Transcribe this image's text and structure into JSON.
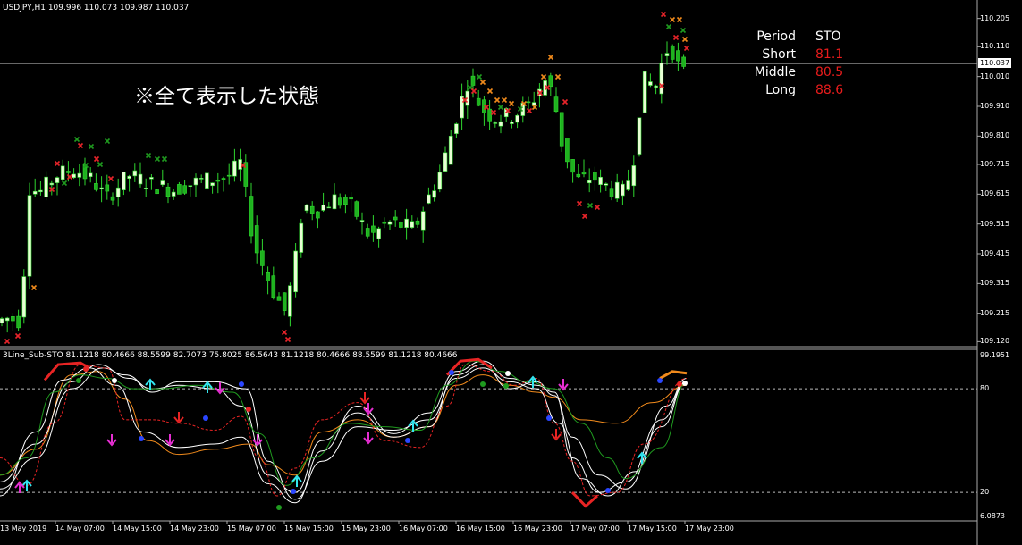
{
  "chart_title": "USDJPY,H1  109.996 110.073 109.987 110.037",
  "annotation_note": "※全て表示した状態",
  "current_price_label": "110.037",
  "sto_panel": {
    "header": {
      "label": "Period",
      "value": "STO"
    },
    "rows": [
      {
        "label": "Short",
        "value": "81.1"
      },
      {
        "label": "Middle",
        "value": "80.5"
      },
      {
        "label": "Long",
        "value": "88.6"
      }
    ]
  },
  "subwindow_title": "3Line_Sub-STO 81.1218 80.4666 88.5599 82.7073 75.8025 86.5643 81.1218 80.4666 88.5599 81.1218 80.4666",
  "colors": {
    "background": "#000000",
    "bull_candle": "#e8ffd4",
    "bear_candle": "#1fb21f",
    "wick": "#2fd62f",
    "marker_red": "#e8242a",
    "marker_orange": "#f08a1c",
    "marker_green": "#1f9a1f",
    "sub_white": "#ffffff",
    "sub_orange": "#f08a1c",
    "sub_red": "#e82424",
    "sub_green": "#1f9a1f",
    "arrow_cyan": "#32e6f0",
    "arrow_magenta": "#e62ed2",
    "dot_blue": "#2a46ff"
  },
  "chart_data": [
    {
      "type": "candlestick",
      "symbol": "USDJPY",
      "timeframe": "H1",
      "ohlc": {
        "open": 109.996,
        "high": 110.073,
        "low": 109.987,
        "close": 110.037
      },
      "y_ticks": [
        "110.205",
        "110.110",
        "110.010",
        "109.910",
        "109.810",
        "109.715",
        "109.615",
        "109.515",
        "109.415",
        "109.315",
        "109.215",
        "109.120"
      ],
      "y_range": [
        109.115,
        110.225
      ],
      "markers_shown": [
        "red-x",
        "orange-x",
        "green-x"
      ]
    },
    {
      "type": "line",
      "title": "3Line_Sub-STO",
      "values_printed": [
        81.1218,
        80.4666,
        88.5599,
        82.7073,
        75.8025,
        86.5643,
        81.1218,
        80.4666,
        88.5599,
        81.1218,
        80.4666
      ],
      "y_ticks": [
        "99.1951",
        "80",
        "20",
        "6.0873"
      ],
      "levels": [
        80,
        20
      ],
      "y_range": [
        6.0873,
        99.1951
      ],
      "x_ticks": [
        "13 May 2019",
        "14 May 07:00",
        "14 May 15:00",
        "14 May 23:00",
        "15 May 07:00",
        "15 May 15:00",
        "15 May 23:00",
        "16 May 07:00",
        "16 May 15:00",
        "16 May 23:00",
        "17 May 07:00",
        "17 May 15:00",
        "17 May 23:00"
      ]
    }
  ]
}
